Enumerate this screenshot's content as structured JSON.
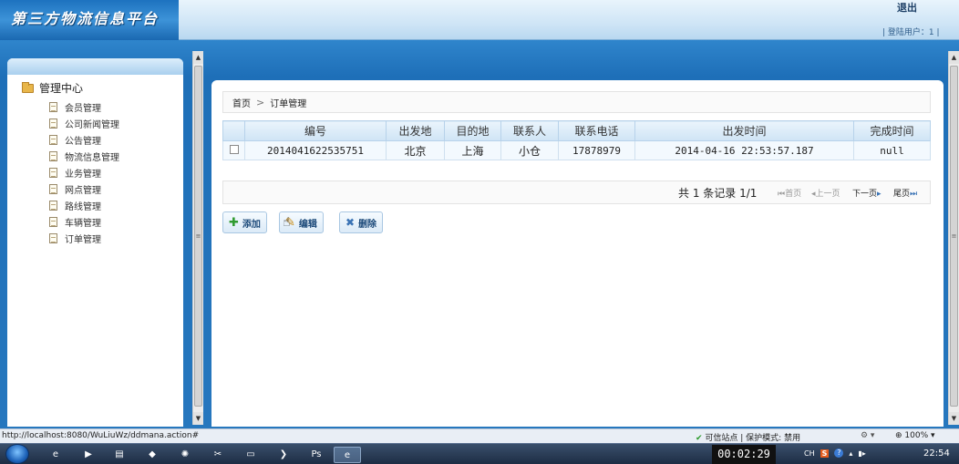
{
  "header": {
    "app_title": "第三方物流信息平台",
    "logout_label": "退出",
    "user_info": "| 登陆用户：1 |"
  },
  "sidebar": {
    "root_label": "管理中心",
    "items": [
      {
        "label": "会员管理"
      },
      {
        "label": "公司新闻管理"
      },
      {
        "label": "公告管理"
      },
      {
        "label": "物流信息管理"
      },
      {
        "label": "业务管理"
      },
      {
        "label": "网点管理"
      },
      {
        "label": "路线管理"
      },
      {
        "label": "车辆管理"
      },
      {
        "label": "订单管理"
      }
    ]
  },
  "breadcrumb": {
    "home": "首页",
    "separator": ">",
    "current": "订单管理"
  },
  "table": {
    "columns": [
      "编号",
      "出发地",
      "目的地",
      "联系人",
      "联系电话",
      "出发时间",
      "完成时间"
    ],
    "rows": [
      {
        "id": "2014041622535751",
        "from": "北京",
        "to": "上海",
        "contact": "小仓",
        "phone": "17878979",
        "depart_time": "2014-04-16 22:53:57.187",
        "finish_time": "null"
      }
    ]
  },
  "pager": {
    "total": "共 1 条记录 1/1",
    "first": "首页",
    "prev": "上一页",
    "next": "下一页",
    "last": "尾页"
  },
  "actions": {
    "add": "添加",
    "edit": "编辑",
    "delete": "删除"
  },
  "statusbar": {
    "url": "http://localhost:8080/WuLiuWz/ddmana.action#",
    "trusted": "可信站点 | 保护模式: 禁用",
    "zoom": "100%"
  },
  "taskbar": {
    "timer": "00:02:29",
    "ime": "CH",
    "clock": "22:54"
  },
  "colors": {
    "frame_blue": "#1e6fb8",
    "header_blue": "#2f85cc",
    "table_header": "#cfe4f5"
  }
}
